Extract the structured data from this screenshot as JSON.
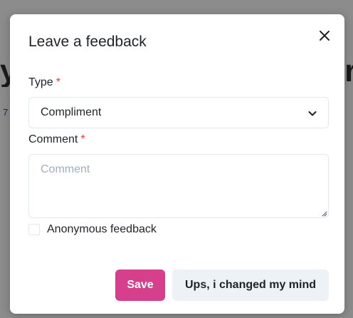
{
  "background": {
    "heading_left_fragment": "y",
    "heading_right_fragment": "r",
    "link_fragment": "7"
  },
  "modal": {
    "title": "Leave a feedback",
    "close_icon": "close-icon",
    "type_field": {
      "label": "Type",
      "required_mark": "*",
      "selected_value": "Compliment",
      "chevron_icon": "chevron-down-icon"
    },
    "comment_field": {
      "label": "Comment",
      "required_mark": "*",
      "placeholder": "Comment",
      "value": ""
    },
    "anonymous": {
      "label": "Anonymous feedback",
      "checked": false
    },
    "actions": {
      "save_label": "Save",
      "cancel_label": "Ups, i changed my mind"
    }
  },
  "colors": {
    "accent": "#d53f8c",
    "required": "#e53e3e",
    "backdrop": "#8c8c8c",
    "secondary_button": "#edf2f7"
  }
}
